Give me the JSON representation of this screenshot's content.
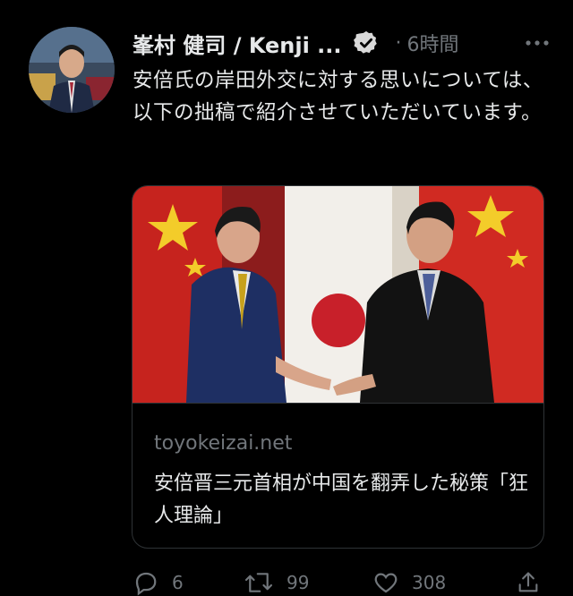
{
  "tweet": {
    "author_name": "峯村 健司 / Kenji ...",
    "separator": "·",
    "timestamp": "6時間",
    "verified_icon": "verified-badge-icon",
    "more_icon": "more-options-icon",
    "text": "安倍氏の岸田外交に対する思いについては、以下の拙稿で紹介させていただいています。"
  },
  "card": {
    "image_description_icon": "photo-handshake",
    "domain": "toyokeizai.net",
    "title": "安倍晋三元首相が中国を翻弄した秘策「狂人理論」"
  },
  "actions": {
    "reply_count": "6",
    "retweet_count": "99",
    "like_count": "308",
    "reply_icon": "reply-icon",
    "retweet_icon": "retweet-icon",
    "like_icon": "heart-icon",
    "share_icon": "share-icon"
  },
  "colors": {
    "background": "#000000",
    "text_primary": "#e7e9ea",
    "text_secondary": "#71767b",
    "border": "#2f3336"
  }
}
